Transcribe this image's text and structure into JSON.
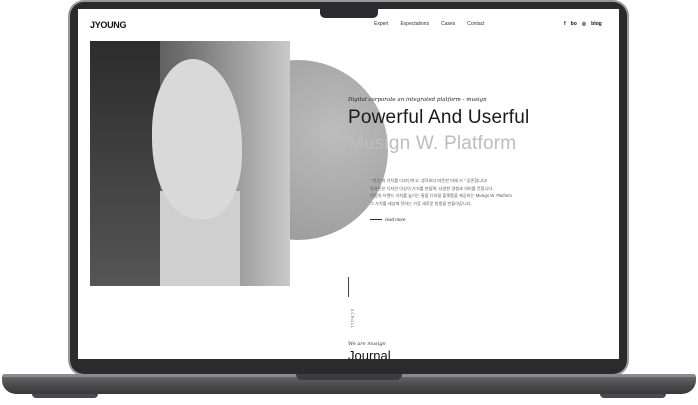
{
  "site": {
    "logo": "JYOUNG",
    "nav": [
      "Expert",
      "Expectations",
      "Cases",
      "Contact"
    ],
    "social": [
      "f",
      "bo",
      "◎",
      "blog"
    ]
  },
  "hero": {
    "tagline": "Digital corporate an integrated platform - musign",
    "title_line1": "Powerful And Userful",
    "title_line2": "Musign W. Platform",
    "body_lines": [
      "\" 인간 의 가치를 디자인하고, 생각보다 따뜻한 미래 가 \" 공존합니다!",
      "뮤사인은 디자인 이상의 가치를 만들며, 다양한 경험과 의미를 전합니다.",
      "기업의 브랜드 가치를 높이는 통합 디지털 플랫폼을 제공하는 Musign W. Platform",
      "그 가치를 세상에 전하는 가장 새로운 방법을 만들어갑니다."
    ],
    "read_more": "read more"
  },
  "side_label": "SCROLL",
  "journal": {
    "subtitle": "We are musign",
    "title": "Journal"
  },
  "colors": {
    "title_dark": "#1a1a1a",
    "title_light": "#bdbdbd",
    "frame": "#2b2b2d"
  }
}
